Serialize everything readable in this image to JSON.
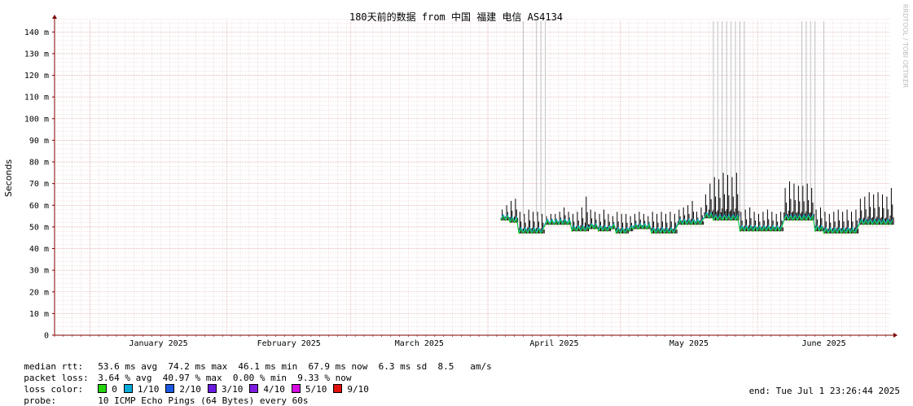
{
  "chart_data": {
    "type": "line",
    "title": "180天前的数据 from 中国 福建 电信 AS4134",
    "ylabel": "Seconds",
    "watermark": "RRDTOOL / TOBI OETIKER",
    "ylim": [
      0,
      145
    ],
    "xlim": [
      "2024-12-24",
      "2025-07-01"
    ],
    "y_ticks": [
      0,
      10,
      20,
      30,
      40,
      50,
      60,
      70,
      80,
      90,
      100,
      110,
      120,
      130,
      140
    ],
    "y_tick_labels": [
      "0",
      "10 m",
      "20 m",
      "30 m",
      "40 m",
      "50 m",
      "60 m",
      "70 m",
      "80 m",
      "90 m",
      "100 m",
      "110 m",
      "120 m",
      "130 m",
      "140 m"
    ],
    "x_ticks": [
      "2025-01-01",
      "2025-02-01",
      "2025-03-01",
      "2025-04-01",
      "2025-05-01",
      "2025-06-01"
    ],
    "x_tick_labels": [
      "January 2025",
      "February 2025",
      "March 2025",
      "April 2025",
      "May 2025",
      "June 2025"
    ],
    "grid": true,
    "series": [
      {
        "name": "median rtt",
        "x": [
          "2025-04-04",
          "2025-04-05",
          "2025-04-06",
          "2025-04-07",
          "2025-04-08",
          "2025-04-09",
          "2025-04-10",
          "2025-04-11",
          "2025-04-12",
          "2025-04-13",
          "2025-04-14",
          "2025-04-15",
          "2025-04-16",
          "2025-04-17",
          "2025-04-18",
          "2025-04-19",
          "2025-04-20",
          "2025-04-21",
          "2025-04-22",
          "2025-04-23",
          "2025-04-24",
          "2025-04-25",
          "2025-04-26",
          "2025-04-27",
          "2025-04-28",
          "2025-04-29",
          "2025-04-30",
          "2025-05-01",
          "2025-05-02",
          "2025-05-03",
          "2025-05-04",
          "2025-05-05",
          "2025-05-06",
          "2025-05-07",
          "2025-05-08",
          "2025-05-09",
          "2025-05-10",
          "2025-05-11",
          "2025-05-12",
          "2025-05-13",
          "2025-05-14",
          "2025-05-15",
          "2025-05-16",
          "2025-05-17",
          "2025-05-18",
          "2025-05-19",
          "2025-05-20",
          "2025-05-21",
          "2025-05-22",
          "2025-05-23",
          "2025-05-24",
          "2025-05-25",
          "2025-05-26",
          "2025-05-27",
          "2025-05-28",
          "2025-05-29",
          "2025-05-30",
          "2025-05-31",
          "2025-06-01",
          "2025-06-02",
          "2025-06-03",
          "2025-06-04",
          "2025-06-05",
          "2025-06-06",
          "2025-06-07",
          "2025-06-08",
          "2025-06-09",
          "2025-06-10",
          "2025-06-11",
          "2025-06-12",
          "2025-06-13",
          "2025-06-14",
          "2025-06-15",
          "2025-06-16",
          "2025-06-17",
          "2025-06-18",
          "2025-06-19",
          "2025-06-20",
          "2025-06-21",
          "2025-06-22",
          "2025-06-23",
          "2025-06-24",
          "2025-06-25",
          "2025-06-26",
          "2025-06-27",
          "2025-06-28",
          "2025-06-29",
          "2025-06-30",
          "2025-07-01"
        ],
        "low": [
          53,
          53,
          52,
          52,
          47,
          47,
          47,
          47,
          47,
          47,
          51,
          51,
          51,
          51,
          51,
          51,
          48,
          48,
          48,
          48,
          49,
          49,
          48,
          48,
          48,
          49,
          47,
          47,
          47,
          48,
          49,
          49,
          49,
          49,
          47,
          47,
          47,
          47,
          47,
          47,
          51,
          51,
          51,
          51,
          51,
          51,
          54,
          54,
          53,
          53,
          53,
          53,
          53,
          53,
          48,
          48,
          48,
          48,
          48,
          48,
          48,
          48,
          48,
          48,
          53,
          53,
          53,
          53,
          53,
          53,
          53,
          48,
          48,
          47,
          47,
          47,
          47,
          47,
          47,
          47,
          47,
          51,
          51,
          51,
          51,
          51,
          51,
          51,
          51
        ],
        "high": [
          58,
          60,
          62,
          63,
          57,
          56,
          58,
          57,
          57,
          56,
          55,
          56,
          56,
          57,
          59,
          57,
          56,
          57,
          59,
          64,
          58,
          57,
          56,
          58,
          56,
          55,
          57,
          56,
          56,
          55,
          56,
          57,
          56,
          55,
          57,
          56,
          57,
          56,
          57,
          56,
          58,
          59,
          60,
          62,
          57,
          59,
          65,
          70,
          73,
          72,
          75,
          74,
          73,
          75,
          57,
          58,
          59,
          57,
          56,
          57,
          58,
          57,
          56,
          57,
          68,
          71,
          70,
          69,
          69,
          70,
          68,
          58,
          59,
          57,
          56,
          57,
          58,
          57,
          58,
          57,
          58,
          63,
          64,
          66,
          65,
          66,
          65,
          64,
          68
        ]
      }
    ],
    "loss_spikes": [
      "2025-04-09",
      "2025-04-12",
      "2025-04-13",
      "2025-04-14",
      "2025-05-22",
      "2025-05-23",
      "2025-05-24",
      "2025-05-25",
      "2025-05-26",
      "2025-05-27",
      "2025-05-28",
      "2025-05-29",
      "2025-06-11",
      "2025-06-12",
      "2025-06-13",
      "2025-06-14",
      "2025-06-16"
    ],
    "colors": {
      "background": "#ffffff",
      "grid_minor": "#e8c8c8",
      "grid_major": "#d89a9a",
      "axis": "#800000",
      "smoke": "#000000",
      "median_loss0": "#23d40a",
      "median_loss1": "#08abd8",
      "spike": "#c0c0c0",
      "watermark": "#bdbdbd"
    }
  },
  "stats": {
    "rtt_label": "median rtt:",
    "rtt_text": "53.6 ms avg  74.2 ms max  46.1 ms min  67.9 ms now  6.3 ms sd  8.5   am/s",
    "loss_label": "packet loss:",
    "loss_text": "3.64 % avg  40.97 % max  0.00 % min  9.33 % now",
    "color_label": "loss color:",
    "loss_colors": [
      {
        "label": "0",
        "color": "#23d40a"
      },
      {
        "label": "1/10",
        "color": "#08abd8"
      },
      {
        "label": "2/10",
        "color": "#1a5ae0"
      },
      {
        "label": "3/10",
        "color": "#6a1ae0"
      },
      {
        "label": "4/10",
        "color": "#7f1ae0"
      },
      {
        "label": "5/10",
        "color": "#d40ae0"
      },
      {
        "label": "9/10",
        "color": "#e0100a"
      }
    ],
    "probe_label": "probe:",
    "probe_text": "10 ICMP Echo Pings (64 Bytes) every 60s",
    "end_text": "end: Tue Jul  1 23:26:44 2025"
  }
}
